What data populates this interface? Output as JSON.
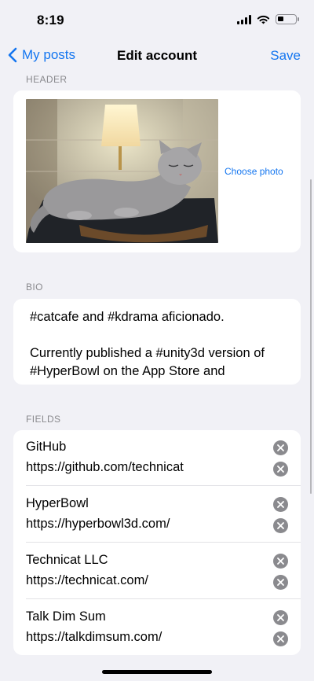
{
  "status": {
    "time": "8:19"
  },
  "nav": {
    "back_label": "My posts",
    "title": "Edit account",
    "save_label": "Save"
  },
  "header_section": {
    "label": "HEADER",
    "choose_photo": "Choose photo"
  },
  "bio_section": {
    "label": "BIO",
    "text": "#catcafe and #kdrama aficionado.\n\nCurrently published a #unity3d version of #HyperBowl on the App Store and"
  },
  "fields_section": {
    "label": "FIELDS",
    "items": [
      {
        "name": "GitHub",
        "value": "https://github.com/technicat"
      },
      {
        "name": "HyperBowl",
        "value": "https://hyperbowl3d.com/"
      },
      {
        "name": "Technicat LLC",
        "value": "https://technicat.com/"
      },
      {
        "name": "Talk Dim Sum",
        "value": "https://talkdimsum.com/"
      }
    ]
  },
  "colors": {
    "accent": "#1476f0",
    "background": "#f1f1f6",
    "secondary_text": "#8a8a8e"
  }
}
